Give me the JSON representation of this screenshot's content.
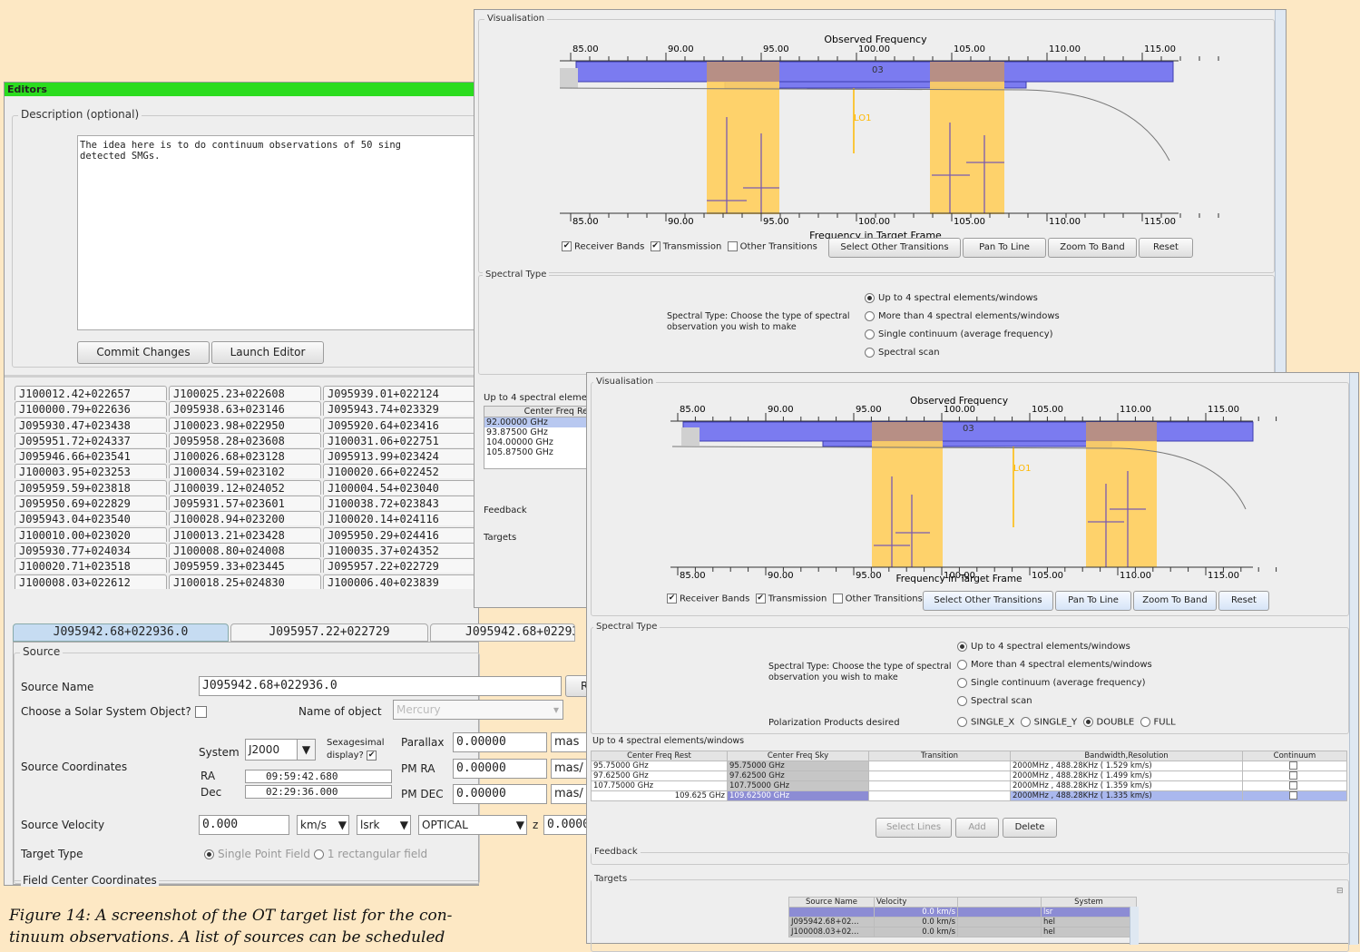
{
  "caption": "Figure 14: A screenshot of the OT target list for the con-",
  "caption_line2": "tinuum observations. A list of sources can be scheduled",
  "editors": {
    "title": "Editors",
    "description_label": "Description (optional)",
    "description_text": "The idea here is to do continuum observations of 50 sing\ndetected SMGs.",
    "commit_label": "Commit Changes",
    "launch_label": "Launch Editor",
    "source_tabs": [
      [
        "J100012.42+022657",
        "J100025.23+022608",
        "J095939.01+022124"
      ],
      [
        "J100000.79+022636",
        "J095938.63+023146",
        "J095943.74+023329"
      ],
      [
        "J095930.47+023438",
        "J100023.98+022950",
        "J095920.64+023416"
      ],
      [
        "J095951.72+024337",
        "J095958.28+023608",
        "J100031.06+022751"
      ],
      [
        "J095946.66+023541",
        "J100026.68+023128",
        "J095913.99+023424"
      ],
      [
        "J100003.95+023253",
        "J100034.59+023102",
        "J100020.66+022452"
      ],
      [
        "J095959.59+023818",
        "J100039.12+024052",
        "J100004.54+023040"
      ],
      [
        "J095950.69+022829",
        "J095931.57+023601",
        "J100038.72+023843"
      ],
      [
        "J095943.04+023540",
        "J100028.94+023200",
        "J100020.14+024116"
      ],
      [
        "J100010.00+023020",
        "J100013.21+023428",
        "J095950.29+024416"
      ],
      [
        "J095930.77+024034",
        "J100008.80+024008",
        "J100035.37+024352"
      ],
      [
        "J100020.71+023518",
        "J095959.33+023445",
        "J095957.22+022729"
      ],
      [
        "J100008.03+022612",
        "J100018.25+024830",
        "J100006.40+023839"
      ]
    ],
    "bottom_tabs": [
      "J095942.68+022936.0",
      "J095957.22+022729",
      "J095942.68+02293"
    ],
    "source": {
      "group_label": "Source",
      "name_label": "Source Name",
      "name_value": "J095942.68+022936.0",
      "resolve_btn": "R",
      "solar_label": "Choose a Solar System Object?",
      "object_label": "Name of object",
      "object_value": "Mercury",
      "coords_label": "Source Coordinates",
      "system_label": "System",
      "system_value": "J2000",
      "sexa_label1": "Sexagesimal",
      "sexa_label2": "display?",
      "ra_label": "RA",
      "ra_value": "09:59:42.680",
      "dec_label": "Dec",
      "dec_value": "02:29:36.000",
      "parallax_label": "Parallax",
      "parallax_value": "0.00000",
      "parallax_unit": "mas",
      "pmra_label": "PM RA",
      "pmra_value": "0.00000",
      "pmra_unit": "mas/",
      "pmdec_label": "PM DEC",
      "pmdec_value": "0.00000",
      "pmdec_unit": "mas/",
      "velocity_label": "Source Velocity",
      "velocity_value": "0.000",
      "vel_unit": "km/s",
      "vel_frame": "lsrk",
      "vel_def": "OPTICAL",
      "z_label": "z",
      "z_value": "0.0000",
      "target_type_label": "Target Type",
      "tt_opt1": "Single Point Field",
      "tt_opt2": "1 rectangular field",
      "field_center_label": "Field Center Coordinates"
    }
  },
  "back_panel": {
    "vis_label": "Visualisation",
    "observed_freq": "Observed Frequency",
    "target_frame": "Frequency in Target Frame",
    "top_ticks": [
      "85.00",
      "90.00",
      "95.00",
      "100.00",
      "105.00",
      "110.00",
      "115.00"
    ],
    "bottom_ticks": [
      "85.00",
      "90.00",
      "95.00",
      "100.00",
      "105.00",
      "110.00",
      "115.00"
    ],
    "band_label": "03",
    "lo_label": "LO1",
    "cb_receiver": "Receiver Bands",
    "cb_transmission": "Transmission",
    "cb_other": "Other Transitions",
    "btn_select_other": "Select Other Transitions",
    "btn_pan": "Pan To Line",
    "btn_zoom": "Zoom To Band",
    "btn_reset": "Reset",
    "spectral_label": "Spectral Type",
    "spectral_prompt1": "Spectral Type: Choose the type of spectral",
    "spectral_prompt2": "observation you wish to make",
    "spectral_opts": [
      "Up to 4 spectral elements/windows",
      "More than 4 spectral elements/windows",
      "Single continuum (average frequency)",
      "Spectral scan"
    ],
    "windows_label": "Up to 4 spectral eleme",
    "windows_col": "Center Freq Re",
    "windows_rows": [
      "92.00000 GHz",
      "93.87500 GHz",
      "104.00000 GHz",
      "105.87500 GHz"
    ],
    "feedback_label": "Feedback",
    "targets_label": "Targets"
  },
  "front_panel": {
    "vis_label": "Visualisation",
    "observed_freq": "Observed Frequency",
    "target_frame": "Frequency in Target Frame",
    "top_ticks": [
      "85.00",
      "90.00",
      "95.00",
      "100.00",
      "105.00",
      "110.00",
      "115.00"
    ],
    "bottom_ticks": [
      "85.00",
      "90.00",
      "95.00",
      "100.00",
      "105.00",
      "110.00",
      "115.00"
    ],
    "band_label": "03",
    "lo_label": "LO1",
    "cb_receiver": "Receiver Bands",
    "cb_transmission": "Transmission",
    "cb_other": "Other Transitions",
    "btn_select_other": "Select Other Transitions",
    "btn_pan": "Pan To Line",
    "btn_zoom": "Zoom To Band",
    "btn_reset": "Reset",
    "spectral_label": "Spectral Type",
    "spectral_prompt1": "Spectral Type: Choose the type of spectral",
    "spectral_prompt2": "observation you wish to make",
    "spectral_opts": [
      "Up to 4 spectral elements/windows",
      "More than 4 spectral elements/windows",
      "Single continuum (average frequency)",
      "Spectral scan"
    ],
    "polarization_label": "Polarization Products desired",
    "pol_opts": [
      "SINGLE_X",
      "SINGLE_Y",
      "DOUBLE",
      "FULL"
    ],
    "windows_label": "Up to 4 spectral elements/windows",
    "windows_headers": [
      "Center Freq Rest",
      "Center Freq Sky",
      "Transition",
      "Bandwidth,Resolution",
      "Continuum"
    ],
    "windows_rows": [
      [
        "95.75000 GHz",
        "95.75000 GHz",
        "",
        "2000MHz , 488.28KHz (  1.529 km/s)"
      ],
      [
        "97.62500 GHz",
        "97.62500 GHz",
        "",
        "2000MHz , 488.28KHz (  1.499 km/s)"
      ],
      [
        "107.75000 GHz",
        "107.75000 GHz",
        "",
        "2000MHz , 488.28KHz (  1.359 km/s)"
      ],
      [
        "109.625 GHz",
        "109.62500 GHz",
        "",
        "2000MHz , 488.28KHz (  1.335 km/s)"
      ]
    ],
    "btn_select_lines": "Select Lines",
    "btn_add": "Add",
    "btn_delete": "Delete",
    "feedback_label": "Feedback",
    "targets_label": "Targets",
    "targets_headers": [
      "Source Name",
      "Velocity",
      "",
      "System"
    ],
    "targets_rows": [
      [
        "",
        "0.0 km/s",
        "",
        "lsr"
      ],
      [
        "J095942.68+02...",
        "0.0 km/s",
        "",
        "hel"
      ],
      [
        "J100008.03+02...",
        "0.0 km/s",
        "",
        "hel"
      ]
    ]
  },
  "colors": {
    "band": "#7b7bf0",
    "window": "#ffcf60",
    "green": "#2bdc1e",
    "select": "#aab8ee"
  }
}
